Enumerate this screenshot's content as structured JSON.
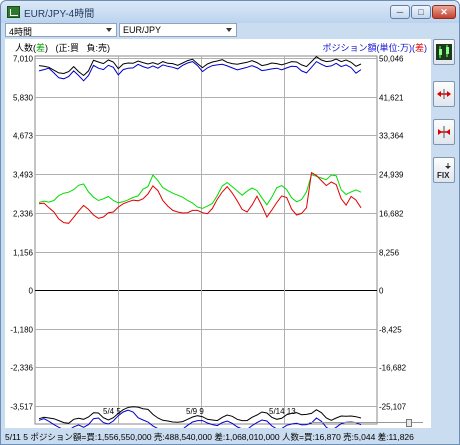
{
  "window": {
    "title": "EUR/JPY-4時間",
    "minimize_label": "─",
    "maximize_label": "□",
    "close_label": "✕"
  },
  "toolbar": {
    "period_value": "4時間",
    "pair_value": "EUR/JPY"
  },
  "legend": {
    "left_prefix": "人数(",
    "left_diff": "差",
    "left_suffix": ")",
    "left_buy": "(正:買",
    "left_sell": "負:売)",
    "right_prefix": "ポジション額(単位:万)(",
    "right_diff": "差",
    "right_suffix": ")"
  },
  "axes": {
    "left_ticks": [
      "7,010",
      "5,830",
      "4,673",
      "3,493",
      "2,336",
      "1,156",
      "0",
      "-1,180",
      "-2,336",
      "-3,517"
    ],
    "right_ticks": [
      "50,046",
      "41,621",
      "33,364",
      "24,939",
      "16,682",
      "8,256",
      "0",
      "-8,425",
      "-16,682",
      "-25,107"
    ],
    "x_labels": [
      "5/4 5",
      "5/9 9",
      "5/14 13"
    ]
  },
  "chart_data": {
    "type": "line",
    "x_labels": [
      "5/4 5",
      "5/9 9",
      "5/14 13"
    ],
    "ylim_left": [
      -4400,
      7300
    ],
    "ylim_right": [
      -31500,
      52100
    ],
    "series": [
      {
        "panel": "buy",
        "color": "#000000",
        "axis": "left",
        "values": [
          6780,
          6760,
          6730,
          6640,
          6560,
          6540,
          6600,
          6750,
          6600,
          6480,
          6620,
          6940,
          6890,
          6840,
          6950,
          6890,
          6690,
          6830,
          6860,
          6850,
          6920,
          6870,
          6830,
          6870,
          6820,
          6900,
          6850,
          6840,
          6790,
          6860,
          6930,
          6970,
          6840,
          6720,
          6830,
          6890,
          6920,
          6960,
          6880,
          6840,
          6820,
          6850,
          6880,
          6930,
          6870,
          6780,
          6810,
          6860,
          6840,
          6800,
          6850,
          6900,
          6890,
          6800,
          6750,
          6900,
          7050,
          6950,
          6900,
          6920,
          6980,
          6900,
          6950,
          6880,
          6760,
          6830
        ]
      },
      {
        "panel": "buy",
        "color": "#0000d0",
        "axis": "left",
        "values": [
          6620,
          6660,
          6700,
          6560,
          6410,
          6380,
          6450,
          6620,
          6480,
          6320,
          6480,
          6790,
          6700,
          6660,
          6790,
          6730,
          6500,
          6660,
          6700,
          6710,
          6820,
          6750,
          6700,
          6770,
          6700,
          6800,
          6760,
          6730,
          6680,
          6790,
          6860,
          6900,
          6780,
          6600,
          6710,
          6780,
          6800,
          6820,
          6770,
          6710,
          6650,
          6690,
          6730,
          6780,
          6720,
          6630,
          6650,
          6680,
          6700,
          6650,
          6710,
          6760,
          6750,
          6620,
          6560,
          6730,
          6900,
          6820,
          6750,
          6770,
          6850,
          6750,
          6800,
          6720,
          6550,
          6660
        ]
      },
      {
        "panel": "diff",
        "color": "#00dd00",
        "axis": "left",
        "values": [
          2640,
          2680,
          2650,
          2700,
          2850,
          2920,
          2950,
          3030,
          3160,
          3200,
          2960,
          2800,
          2700,
          2750,
          2820,
          2700,
          2630,
          2660,
          2720,
          2790,
          2840,
          3040,
          3120,
          3470,
          3300,
          3090,
          3000,
          2920,
          2860,
          2800,
          2700,
          2620,
          2500,
          2460,
          2530,
          2610,
          2850,
          3140,
          3240,
          3120,
          2990,
          2860,
          2980,
          3080,
          3000,
          2780,
          2570,
          2800,
          3090,
          3150,
          3030,
          2780,
          2660,
          2730,
          2960,
          3480,
          3430,
          3380,
          3330,
          3470,
          3450,
          3020,
          2880,
          2960,
          3020,
          2950
        ]
      },
      {
        "panel": "diff",
        "color": "#e00000",
        "axis": "left",
        "values": [
          2600,
          2620,
          2480,
          2350,
          2140,
          2030,
          2010,
          2190,
          2380,
          2550,
          2430,
          2260,
          2160,
          2200,
          2330,
          2350,
          2500,
          2600,
          2660,
          2710,
          2690,
          2750,
          2900,
          3140,
          3000,
          2700,
          2530,
          2400,
          2350,
          2320,
          2330,
          2400,
          2400,
          2330,
          2300,
          2460,
          2740,
          2960,
          3120,
          2930,
          2690,
          2430,
          2350,
          2560,
          2830,
          2540,
          2200,
          2410,
          2640,
          2840,
          2790,
          2440,
          2260,
          2310,
          2480,
          3540,
          3460,
          3300,
          3150,
          3260,
          3180,
          2750,
          2560,
          2820,
          2710,
          2480
        ]
      },
      {
        "panel": "sell",
        "color": "#000000",
        "axis": "left",
        "values": [
          -3900,
          -3860,
          -3880,
          -3900,
          -3960,
          -4020,
          -4040,
          -3920,
          -3890,
          -3920,
          -3850,
          -3720,
          -3730,
          -3870,
          -3940,
          -3870,
          -3740,
          -3630,
          -3560,
          -3540,
          -3550,
          -3600,
          -3620,
          -3770,
          -3880,
          -3950,
          -3970,
          -4000,
          -4010,
          -3990,
          -3920,
          -3850,
          -3810,
          -3840,
          -3920,
          -3940,
          -3960,
          -3860,
          -3790,
          -3830,
          -3920,
          -3960,
          -3960,
          -3860,
          -3790,
          -3700,
          -3730,
          -3860,
          -3920,
          -3890,
          -3780,
          -3740,
          -3720,
          -3780,
          -3770,
          -3740,
          -3630,
          -3720,
          -3880,
          -3950,
          -3880,
          -3820,
          -3830,
          -3820,
          -3840,
          -3880
        ]
      },
      {
        "panel": "sell",
        "color": "#0000d0",
        "axis": "left",
        "values": [
          -3950,
          -3900,
          -3980,
          -4080,
          -4160,
          -4230,
          -4250,
          -4150,
          -4090,
          -4160,
          -4080,
          -3900,
          -3880,
          -4020,
          -4060,
          -3970,
          -3810,
          -3700,
          -3640,
          -3700,
          -3870,
          -3940,
          -4000,
          -4120,
          -4200,
          -4290,
          -4280,
          -4280,
          -4280,
          -4220,
          -4100,
          -4000,
          -3960,
          -3960,
          -4030,
          -4080,
          -4110,
          -4020,
          -3970,
          -4040,
          -4150,
          -4210,
          -4230,
          -4110,
          -4020,
          -3940,
          -3970,
          -4120,
          -4210,
          -4200,
          -4100,
          -4060,
          -4040,
          -4090,
          -4080,
          -4030,
          -3880,
          -3980,
          -4160,
          -4260,
          -4160,
          -4050,
          -4010,
          -4000,
          -4020,
          -4080
        ]
      }
    ]
  },
  "status": {
    "text": "5/11 5  ポジション額=買:1,556,550,000 売:488,540,000 差:1,068,010,000 人数=買:16,870 売:5,044 差:11,826"
  },
  "sidebar": {
    "fix_label": "FIX"
  },
  "colors": {
    "buy_line": "#000000",
    "sell_line": "#0000d0",
    "diff_positive": "#00dd00",
    "diff_negative": "#e00000",
    "grid": "#a0a0a0"
  }
}
